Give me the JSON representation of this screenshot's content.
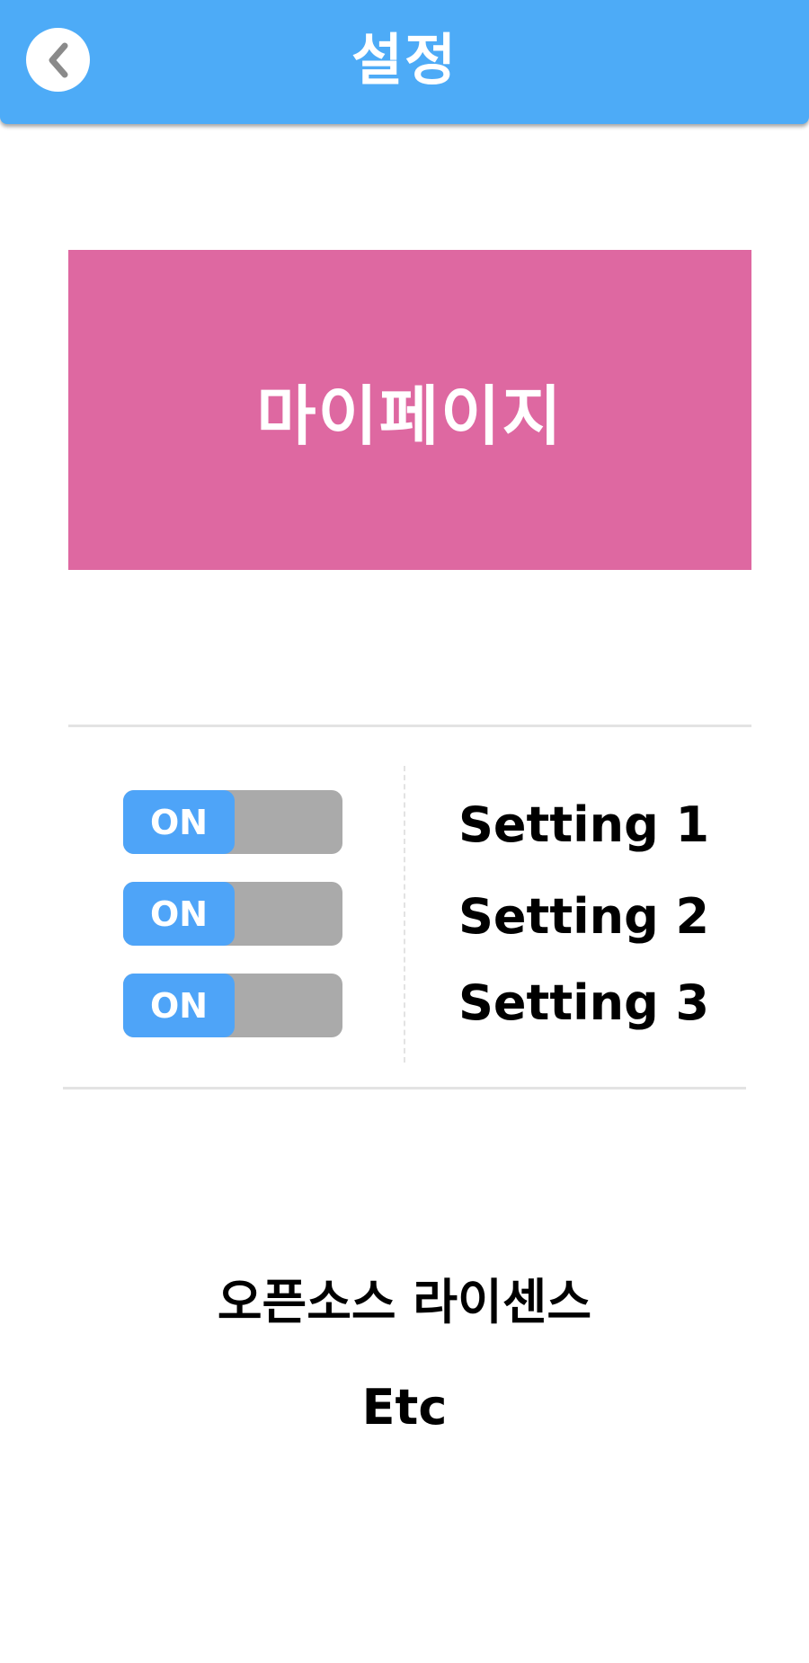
{
  "header": {
    "title": "설정",
    "back_icon": "chevron-left-icon",
    "background_color": "#4dabf7"
  },
  "mypage": {
    "label": "마이페이지",
    "background_color": "#de68a1"
  },
  "settings": [
    {
      "toggle_label": "ON",
      "name": "Setting 1"
    },
    {
      "toggle_label": "ON",
      "name": "Setting 2"
    },
    {
      "toggle_label": "ON",
      "name": "Setting 3"
    }
  ],
  "links": {
    "license": "오픈소스 라이센스",
    "etc": "Etc"
  },
  "colors": {
    "toggle_on": "#4ea4f8",
    "toggle_track": "#aaaaaa",
    "divider": "#e3e3e3"
  }
}
